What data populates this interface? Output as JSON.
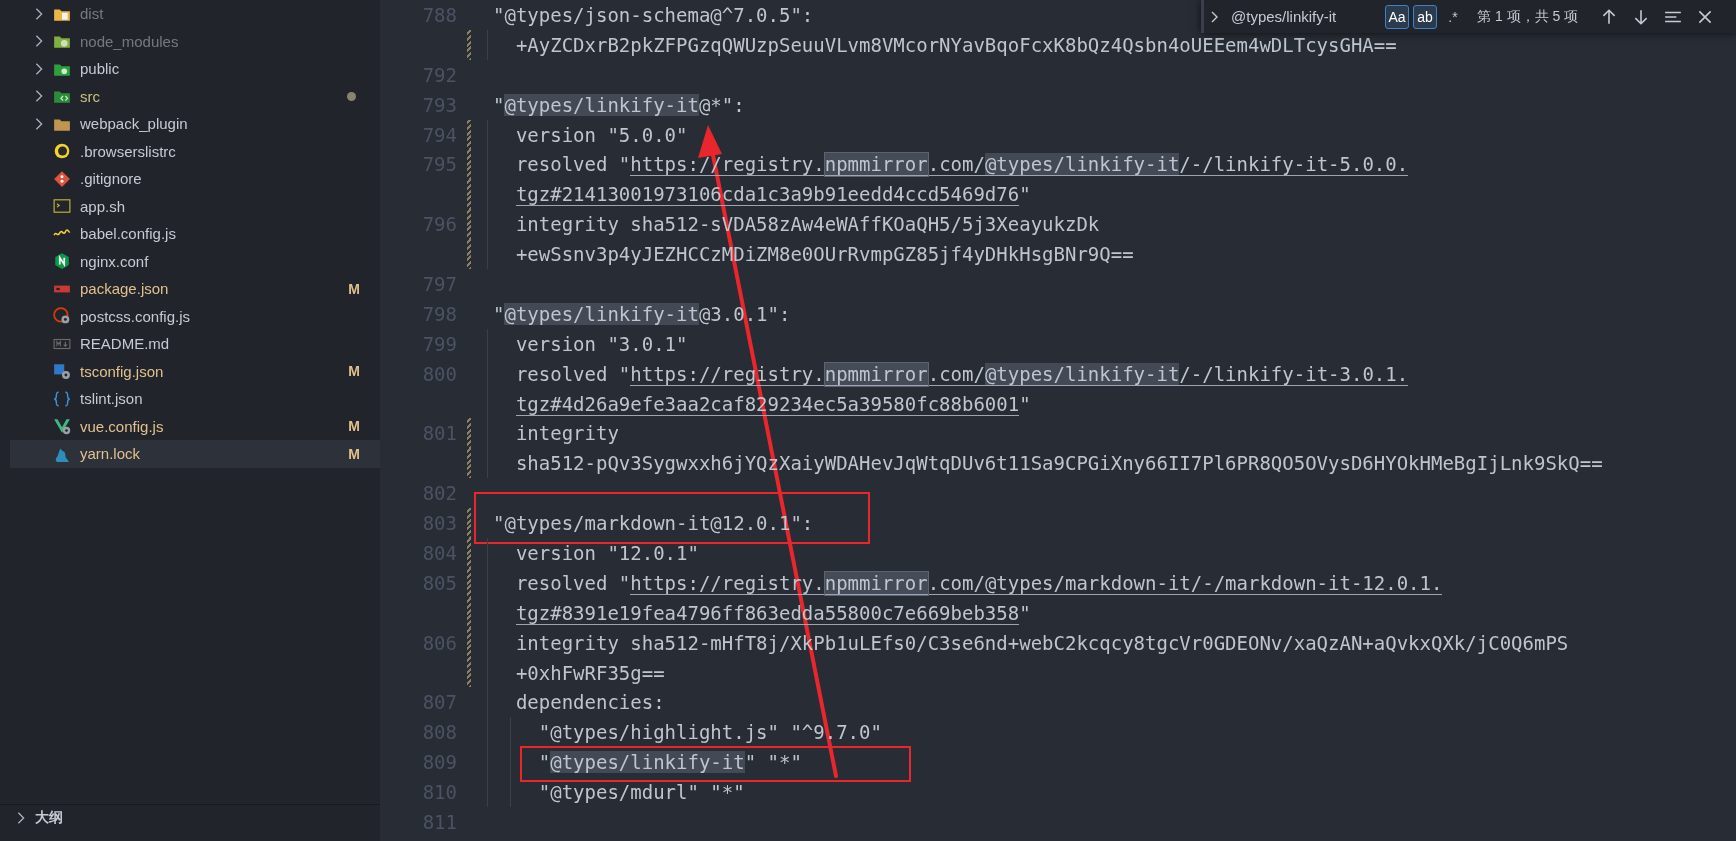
{
  "explorer": {
    "items": [
      {
        "label": "dist",
        "kind": "folder",
        "expanded": false,
        "ignored": true,
        "modified": false,
        "changes_inside": false,
        "selected": false
      },
      {
        "label": "node_modules",
        "kind": "folder",
        "expanded": false,
        "ignored": true,
        "modified": false,
        "changes_inside": false,
        "selected": false
      },
      {
        "label": "public",
        "kind": "folder",
        "expanded": false,
        "ignored": false,
        "modified": false,
        "changes_inside": false,
        "selected": false
      },
      {
        "label": "src",
        "kind": "folder",
        "expanded": false,
        "ignored": false,
        "modified": false,
        "changes_inside": true,
        "selected": false
      },
      {
        "label": "webpack_plugin",
        "kind": "folder",
        "expanded": false,
        "ignored": false,
        "modified": false,
        "changes_inside": false,
        "selected": false
      },
      {
        "label": ".browserslistrc",
        "kind": "file",
        "ignored": false,
        "modified": false,
        "changes_inside": false,
        "selected": false
      },
      {
        "label": ".gitignore",
        "kind": "file",
        "ignored": false,
        "modified": false,
        "changes_inside": false,
        "selected": false
      },
      {
        "label": "app.sh",
        "kind": "file",
        "ignored": false,
        "modified": false,
        "changes_inside": false,
        "selected": false
      },
      {
        "label": "babel.config.js",
        "kind": "file",
        "ignored": false,
        "modified": false,
        "changes_inside": false,
        "selected": false
      },
      {
        "label": "nginx.conf",
        "kind": "file",
        "ignored": false,
        "modified": false,
        "changes_inside": false,
        "selected": false
      },
      {
        "label": "package.json",
        "kind": "file",
        "ignored": false,
        "modified": true,
        "changes_inside": false,
        "badge": "M",
        "selected": false
      },
      {
        "label": "postcss.config.js",
        "kind": "file",
        "ignored": false,
        "modified": false,
        "changes_inside": false,
        "selected": false
      },
      {
        "label": "README.md",
        "kind": "file",
        "ignored": false,
        "modified": false,
        "changes_inside": false,
        "selected": false
      },
      {
        "label": "tsconfig.json",
        "kind": "file",
        "ignored": false,
        "modified": true,
        "changes_inside": false,
        "badge": "M",
        "selected": false
      },
      {
        "label": "tslint.json",
        "kind": "file",
        "ignored": false,
        "modified": false,
        "changes_inside": false,
        "selected": false
      },
      {
        "label": "vue.config.js",
        "kind": "file",
        "ignored": false,
        "modified": true,
        "changes_inside": false,
        "badge": "M",
        "selected": false
      },
      {
        "label": "yarn.lock",
        "kind": "file",
        "ignored": false,
        "modified": true,
        "changes_inside": false,
        "badge": "M",
        "selected": true
      }
    ],
    "sections": [
      {
        "title": "大纲",
        "expanded": false
      }
    ]
  },
  "editor": {
    "rows": [
      {
        "number": "788",
        "modified": false,
        "segments": [
          {
            "text": "\"@types/json-schema@^7.0.5\":"
          }
        ]
      },
      {
        "modified": true,
        "segments": [
          {
            "text": "  +AyZCDxrB2pkZFPGzqQWUzpSeuuVLvm8VMcorNYavBqoFcxK8bQz4Qsbn4oUEEem4wDLTcysGHA=="
          }
        ]
      },
      {
        "number": "792",
        "modified": false
      },
      {
        "number": "793",
        "modified": false,
        "segments": [
          {
            "text": "\""
          },
          {
            "text": "@types/linkify-it",
            "match": true
          },
          {
            "text": "@*\":"
          }
        ]
      },
      {
        "number": "794",
        "modified": true,
        "segments": [
          {
            "text": "  version \"5.0.0\""
          }
        ]
      },
      {
        "number": "795",
        "modified": true,
        "segments": [
          {
            "text": "  resolved \""
          },
          {
            "text": "https://registry.",
            "link": true
          },
          {
            "text": "npmmirror",
            "link": true,
            "word_highlight": true
          },
          {
            "text": ".com/",
            "link": true
          },
          {
            "text": "@types/linkify-it",
            "link": true,
            "match": true
          },
          {
            "text": "/-/linkify-it-5.0.0.",
            "link": true
          }
        ]
      },
      {
        "modified": true,
        "segments": [
          {
            "text": "  tgz#21413001973106cda1c3a9b91eedd4ccd5469d76",
            "link": true
          },
          {
            "text": "\""
          }
        ]
      },
      {
        "number": "796",
        "modified": true,
        "segments": [
          {
            "text": "  integrity sha512-sVDA58zAw4eWAffKOaQH5/5j3XeayukzDk"
          }
        ]
      },
      {
        "modified": true,
        "segments": [
          {
            "text": "  +ewSsnv3p4yJEZHCCzMDiZM8e0OUrRvmpGZ85jf4yDHkHsgBNr9Q=="
          }
        ]
      },
      {
        "number": "797",
        "modified": false
      },
      {
        "number": "798",
        "modified": false,
        "segments": [
          {
            "text": "\""
          },
          {
            "text": "@types/linkify-it",
            "match": true
          },
          {
            "text": "@3.0.1\":"
          }
        ]
      },
      {
        "number": "799",
        "modified": false,
        "segments": [
          {
            "text": "  version \"3.0.1\""
          }
        ]
      },
      {
        "number": "800",
        "modified": false,
        "segments": [
          {
            "text": "  resolved \""
          },
          {
            "text": "https://registry.",
            "link": true
          },
          {
            "text": "npmmirror",
            "link": true,
            "word_highlight": true
          },
          {
            "text": ".com/",
            "link": true
          },
          {
            "text": "@types/linkify-it",
            "link": true,
            "match": true
          },
          {
            "text": "/-/linkify-it-3.0.1.",
            "link": true
          }
        ]
      },
      {
        "modified": false,
        "segments": [
          {
            "text": "  tgz#4d26a9efe3aa2caf829234ec5a39580fc88b6001",
            "link": true
          },
          {
            "text": "\""
          }
        ]
      },
      {
        "number": "801",
        "modified": true,
        "segments": [
          {
            "text": "  integrity"
          }
        ]
      },
      {
        "modified": true,
        "segments": [
          {
            "text": "  sha512-pQv3Sygwxxh6jYQzXaiyWDAHevJqWtqDUv6t11Sa9CPGiXny66II7Pl6PR8QO5OVysD6HYOkHMeBgIjLnk9SkQ=="
          }
        ]
      },
      {
        "number": "802",
        "modified": false
      },
      {
        "number": "803",
        "modified": true,
        "segments": [
          {
            "text": "\"@types/markdown-it@12.0.1\":"
          }
        ]
      },
      {
        "number": "804",
        "modified": true,
        "segments": [
          {
            "text": "  version \"12.0.1\""
          }
        ]
      },
      {
        "number": "805",
        "modified": true,
        "segments": [
          {
            "text": "  resolved \""
          },
          {
            "text": "https://registry.",
            "link": true
          },
          {
            "text": "npmmirror",
            "link": true,
            "word_highlight": true
          },
          {
            "text": ".com/@types/markdown-it/-/markdown-it-12.0.1.",
            "link": true
          }
        ]
      },
      {
        "modified": true,
        "segments": [
          {
            "text": "  tgz#8391e19fea4796ff863edda55800c7e669beb358",
            "link": true
          },
          {
            "text": "\""
          }
        ]
      },
      {
        "number": "806",
        "modified": true,
        "segments": [
          {
            "text": "  integrity sha512-mHfT8j/XkPb1uLEfs0/C3se6nd+webC2kcqcy8tgcVr0GDEONv/xaQzAN+aQvkxQXk/jC0Q6mPS"
          }
        ]
      },
      {
        "modified": true,
        "segments": [
          {
            "text": "  +0xhFwRF35g=="
          }
        ]
      },
      {
        "number": "807",
        "modified": false,
        "segments": [
          {
            "text": "  dependencies:"
          }
        ]
      },
      {
        "number": "808",
        "modified": false,
        "segments": [
          {
            "text": "    \"@types/highlight.js\" \"^9.7.0\""
          }
        ]
      },
      {
        "number": "809",
        "modified": false,
        "segments": [
          {
            "text": "    \""
          },
          {
            "text": "@types/linkify-it",
            "match": true
          },
          {
            "text": "\" \"*\""
          }
        ]
      },
      {
        "number": "810",
        "modified": false,
        "segments": [
          {
            "text": "    \"@types/mdurl\" \"*\""
          }
        ]
      },
      {
        "number": "811",
        "modified": false
      }
    ]
  },
  "find_widget": {
    "value": "@types/linkify-it",
    "options": [
      {
        "label": "Aa",
        "on": true
      },
      {
        "label": "ab",
        "on": true
      },
      {
        "label": ".*",
        "on": false
      }
    ],
    "result": "第 1 项，共 5 项"
  },
  "annotations": [
    {
      "kind": "arrow"
    },
    {
      "kind": "box"
    },
    {
      "kind": "box"
    }
  ]
}
